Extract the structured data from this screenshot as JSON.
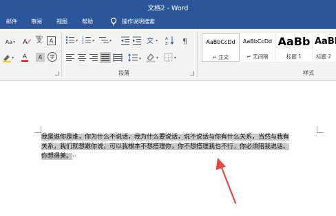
{
  "window": {
    "title": "文档2  -  Word"
  },
  "tabs": [
    {
      "label": "邮件"
    },
    {
      "label": "审阅"
    },
    {
      "label": "视图"
    },
    {
      "label": "帮助"
    },
    {
      "label": "操作说明搜索"
    }
  ],
  "ribbon": {
    "font": {
      "font_size_label": "Aa",
      "phonetic_label": "wén",
      "border_char_label": "A",
      "font_color_label": "A",
      "circle_char_label": "字",
      "shading_label": "A"
    },
    "paragraph": {
      "label": "段落"
    },
    "styles": {
      "label": "样式",
      "items": [
        {
          "sample": "AaBbCcDd",
          "name": "↵ 正文"
        },
        {
          "sample": "AaBbCcDd",
          "name": "↵ 无间隔"
        },
        {
          "sample": "AaBb",
          "name": "标题 1"
        },
        {
          "sample": "AaBb",
          "name": "标题 2"
        }
      ]
    }
  },
  "document": {
    "lines": [
      "我是谁你是谁，你为什么不说话，我为什么要说话，说不说话与你有什么关系，当然与我有",
      "关系，我们就想跟你说，可以我根本不想搭理你，你不想搭理我也不行，你必须陪我说话。",
      "你想得美。"
    ],
    "paragraph_mark": "↵"
  },
  "colors": {
    "title_bar": "#2b579a",
    "selection": "#c8c8c8",
    "annotation_arrow": "#e8473e",
    "font_color_red": "#e00000"
  }
}
